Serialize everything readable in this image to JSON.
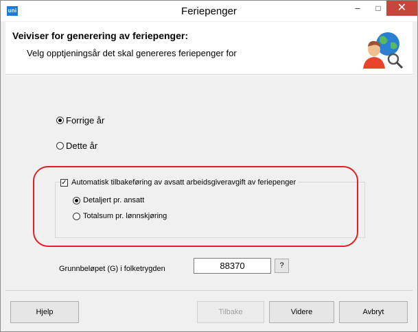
{
  "window": {
    "title": "Feriepenger",
    "app_icon_text": "uni",
    "controls": {
      "minimize": "–",
      "maximize": "□",
      "close": "✕"
    }
  },
  "header": {
    "title": "Veiviser for generering av feriepenger:",
    "subtitle": "Velg opptjeningsår det skal genereres feriepenger for",
    "icon": "user-globe-magnifier-icon"
  },
  "year_options": [
    {
      "label": "Forrige år",
      "selected": true
    },
    {
      "label": "Dette år",
      "selected": false
    }
  ],
  "auto_reversal": {
    "label": "Automatisk tilbakeføring av avsatt arbeidsgiveravgift av feriepenger",
    "checked": true,
    "options": [
      {
        "label": "Detaljert pr. ansatt",
        "selected": true
      },
      {
        "label": "Totalsum pr. lønnskjøring",
        "selected": false
      }
    ]
  },
  "base_amount": {
    "label": "Grunnbeløpet (G) i folketrygden",
    "value": "88370",
    "help_label": "?"
  },
  "buttons": {
    "help": "Hjelp",
    "back": "Tilbake",
    "next": "Videre",
    "cancel": "Avbryt"
  },
  "colors": {
    "highlight_outline": "#e02020",
    "close_button": "#c7463c",
    "app_icon": "#1b7bd8"
  }
}
